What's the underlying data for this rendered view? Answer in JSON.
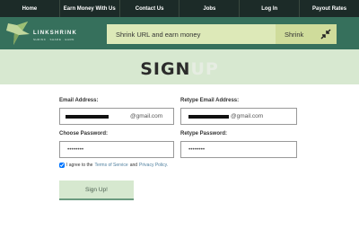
{
  "nav": {
    "items": [
      "Home",
      "Earn Money With Us",
      "Contact Us",
      "Jobs",
      "Log In",
      "Payout Rates"
    ]
  },
  "logo": {
    "wordmark": "LINKSHRINK",
    "tagline": "SHRINK · SHARE · EARN"
  },
  "shrink": {
    "placeholder": "Shrink URL and earn money",
    "button_label": "Shrink"
  },
  "signup": {
    "title_dark": "SIGN",
    "title_light": "UP",
    "email_label": "Email Address:",
    "email_value": "@gmail.com",
    "retype_email_label": "Retype Email Address:",
    "retype_email_value": "@gmail.com",
    "password_label": "Choose Password:",
    "password_value": "password",
    "retype_password_label": "Retype Password:",
    "retype_password_value": "password",
    "agree_prefix": "I agree to the",
    "terms_link": "Terms of Service",
    "agree_and": "and",
    "privacy_link": "Privacy Policy.",
    "submit_label": "Sign Up!"
  },
  "colors": {
    "nav_bg": "#1c2b28",
    "header_bg": "#36705c",
    "band_bg": "#d7e8d0",
    "shrink_bg": "#dde9b8"
  }
}
